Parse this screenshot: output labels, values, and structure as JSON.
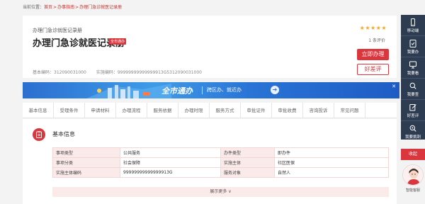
{
  "breadcrumb": {
    "prefix": "当前位置：",
    "items": [
      "首页",
      "办事指南",
      "办理门急诊就医记录册"
    ],
    "sep": ">"
  },
  "header": {
    "small_title": "办理门急诊就医记录册",
    "title": "办理门急诊就医记录册",
    "tag": "全市通办",
    "rating_stars": "★★★★★",
    "eval_count": "1 条评价",
    "handle_button": "立即办理",
    "review_button": "好差评",
    "basic_code": "基本编码：312090031000",
    "impl_code": "实施编码：99999999999999913G5312090031000"
  },
  "banner": {
    "title": "全市通办",
    "subtitle": "跨区办、就近办",
    "arrow": "➔",
    "close": "✕"
  },
  "tabs": [
    "基本信息",
    "受理条件",
    "申请材料",
    "办理流程",
    "服务依据",
    "办理时限",
    "服务方式",
    "审批证件",
    "审批收费",
    "咨询投诉",
    "常见问题"
  ],
  "section": {
    "title": "基本信息",
    "rows": [
      [
        "事项类型",
        "公共服务",
        "办件类型",
        "即办件"
      ],
      [
        "事项分类",
        "社会保障",
        "实施主体",
        "社区医保"
      ],
      [
        "实施主体编码",
        "99999999999999913G",
        "服务对象",
        "自然人"
      ]
    ],
    "more": "展示更多 ∨"
  },
  "rail": {
    "items": [
      "移动端",
      "我要办",
      "我要看",
      "我要查",
      "好差评",
      "我要挑刺"
    ],
    "top": "收起",
    "assistant_label": "智能客服"
  },
  "colors": {
    "accent": "#d9363e",
    "rail": "#2e3c52",
    "banner": "#2a74d6"
  }
}
